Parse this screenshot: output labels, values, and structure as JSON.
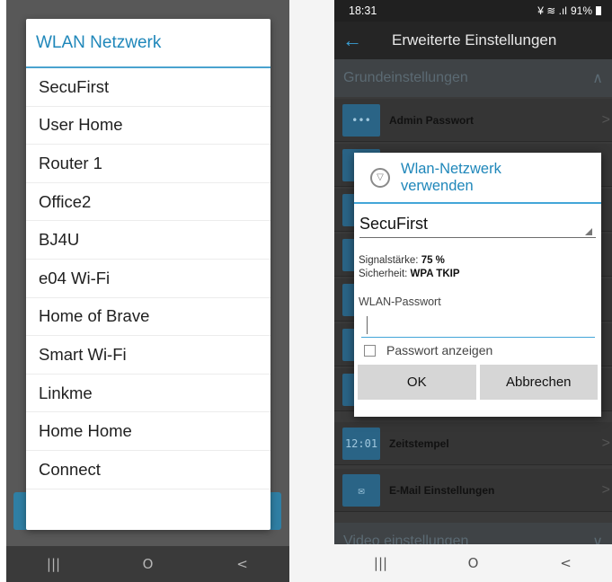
{
  "left": {
    "dialog_title": "WLAN Netzwerk",
    "networks": [
      "SecuFirst",
      "User Home",
      "Router 1",
      "Office2",
      "BJ4U",
      "e04 Wi-Fi",
      "Home of Brave",
      "Smart Wi-Fi",
      "Linkme",
      "Home Home",
      "Connect"
    ],
    "nav": {
      "recent": "|||",
      "home": "O",
      "back": "<"
    }
  },
  "right": {
    "status": {
      "time": "18:31",
      "battery": "91%"
    },
    "app_title": "Erweiterte Einstellungen",
    "sections": {
      "basic": "Grundeinstellungen",
      "video": "Video einstellungen"
    },
    "rows": {
      "admin_password": "Admin Passwort",
      "timestamp": "Zeitstempel",
      "timestamp_icon_text": "12:01",
      "email": "E-Mail Einstellungen"
    },
    "dialog": {
      "title": "Wlan-Netzwerk verwenden",
      "ssid": "SecuFirst",
      "signal_label": "Signalstärke:",
      "signal_value": "75 %",
      "security_label": "Sicherheit:",
      "security_value": "WPA TKIP",
      "password_label": "WLAN-Passwort",
      "password_value": "",
      "show_password_label": "Passwort anzeigen",
      "ok_label": "OK",
      "cancel_label": "Abbrechen"
    },
    "nav": {
      "recent": "|||",
      "home": "O",
      "back": "<"
    }
  },
  "colors": {
    "accent": "#1f87ba",
    "divider": "#43a6d8"
  }
}
